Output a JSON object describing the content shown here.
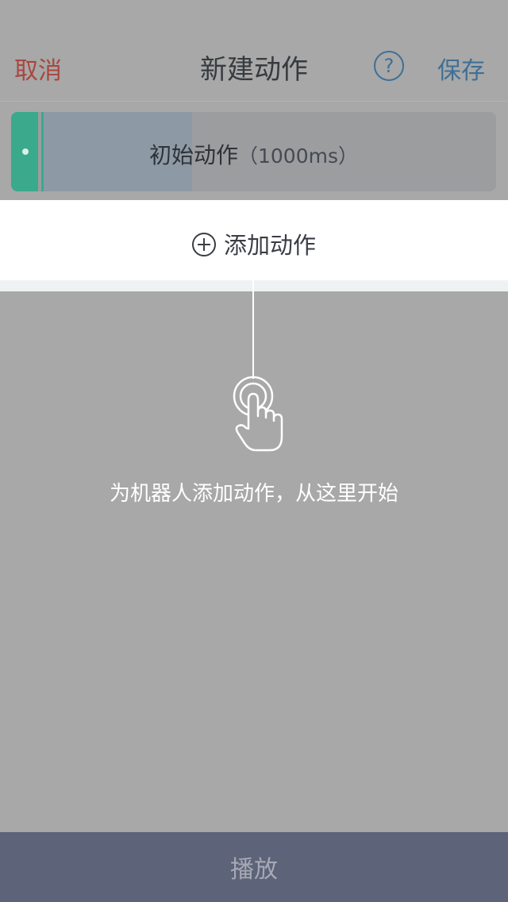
{
  "header": {
    "cancel_label": "取消",
    "title": "新建动作",
    "help_glyph": "?",
    "save_label": "保存"
  },
  "timeline": {
    "first_item": {
      "label": "初始动作",
      "duration": "（1000ms）",
      "progress": 0.33
    }
  },
  "add_action": {
    "label": "添加动作",
    "icon": "plus-circle-icon"
  },
  "guide": {
    "icon": "tap-hand-icon",
    "hint": "为机器人添加动作，从这里开始"
  },
  "footer": {
    "play_label": "播放"
  },
  "colors": {
    "background": "#a7a8a7",
    "cancel": "#a8473f",
    "accent": "#3f6f96",
    "handle": "#3aa98c",
    "progress": "#8d9aa6",
    "play_bar": "#5d6378"
  }
}
